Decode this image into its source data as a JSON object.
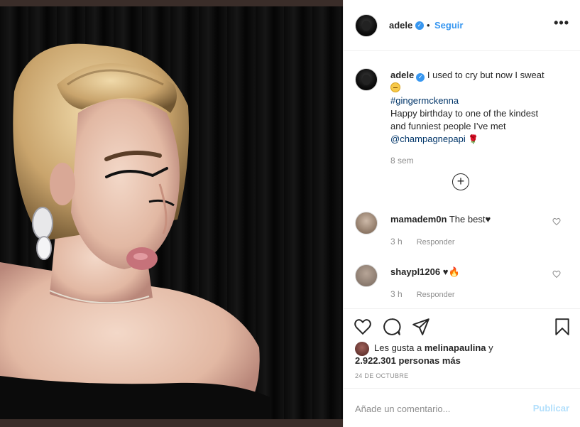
{
  "post": {
    "author": "adele",
    "follow_label": "Seguir",
    "more_label": "•••"
  },
  "caption": {
    "author": "adele",
    "line1": " I used to cry but now I sweat",
    "hashtag": "#gingermckenna",
    "line3": "Happy birthday to one of the kindest",
    "line4": "and funniest people I’ve met",
    "mention": "@champagnepapi",
    "time": "8 sem",
    "load_more": "+"
  },
  "comments": [
    {
      "user": "mamadem0n",
      "text": " The best",
      "time": "3 h",
      "reply": "Responder"
    },
    {
      "user": "shaypl1206",
      "text": "",
      "time": "3 h",
      "reply": "Responder"
    }
  ],
  "likes": {
    "prefix": "Les gusta a ",
    "user": "melinapaulina",
    "suffix": " y",
    "count": "2.922.301 personas más"
  },
  "date": "24 DE OCTUBRE",
  "comment_box": {
    "placeholder": "Añade un comentario...",
    "post_label": "Publicar"
  },
  "colors": {
    "link": "#3897f0",
    "post_disabled": "#b2dffc",
    "hashtag": "#003569"
  },
  "icons": [
    "verified-badge-icon",
    "more-options-icon",
    "heart-icon",
    "comment-icon",
    "share-icon",
    "save-icon",
    "load-more-icon"
  ]
}
